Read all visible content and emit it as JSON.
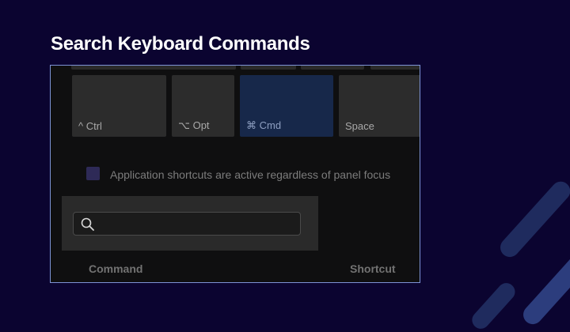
{
  "slide": {
    "title": "Search Keyboard Commands"
  },
  "panel": {
    "modifier_keys": [
      {
        "label": "^ Ctrl"
      },
      {
        "label": "⌥ Opt"
      },
      {
        "label": "⌘ Cmd",
        "active": true
      },
      {
        "label": "Space"
      }
    ],
    "shortcut_checkbox": {
      "label": "Application shortcuts are active regardless of panel focus",
      "checked": false
    },
    "search": {
      "placeholder": "",
      "value": "",
      "icon": "search-icon"
    },
    "columns": {
      "command": "Command",
      "shortcut": "Shortcut"
    }
  },
  "colors": {
    "background": "#0b0430",
    "active_key": "#17284a",
    "border_accent": "#7d93d6",
    "decor_stripe": "#2c3d7d"
  }
}
